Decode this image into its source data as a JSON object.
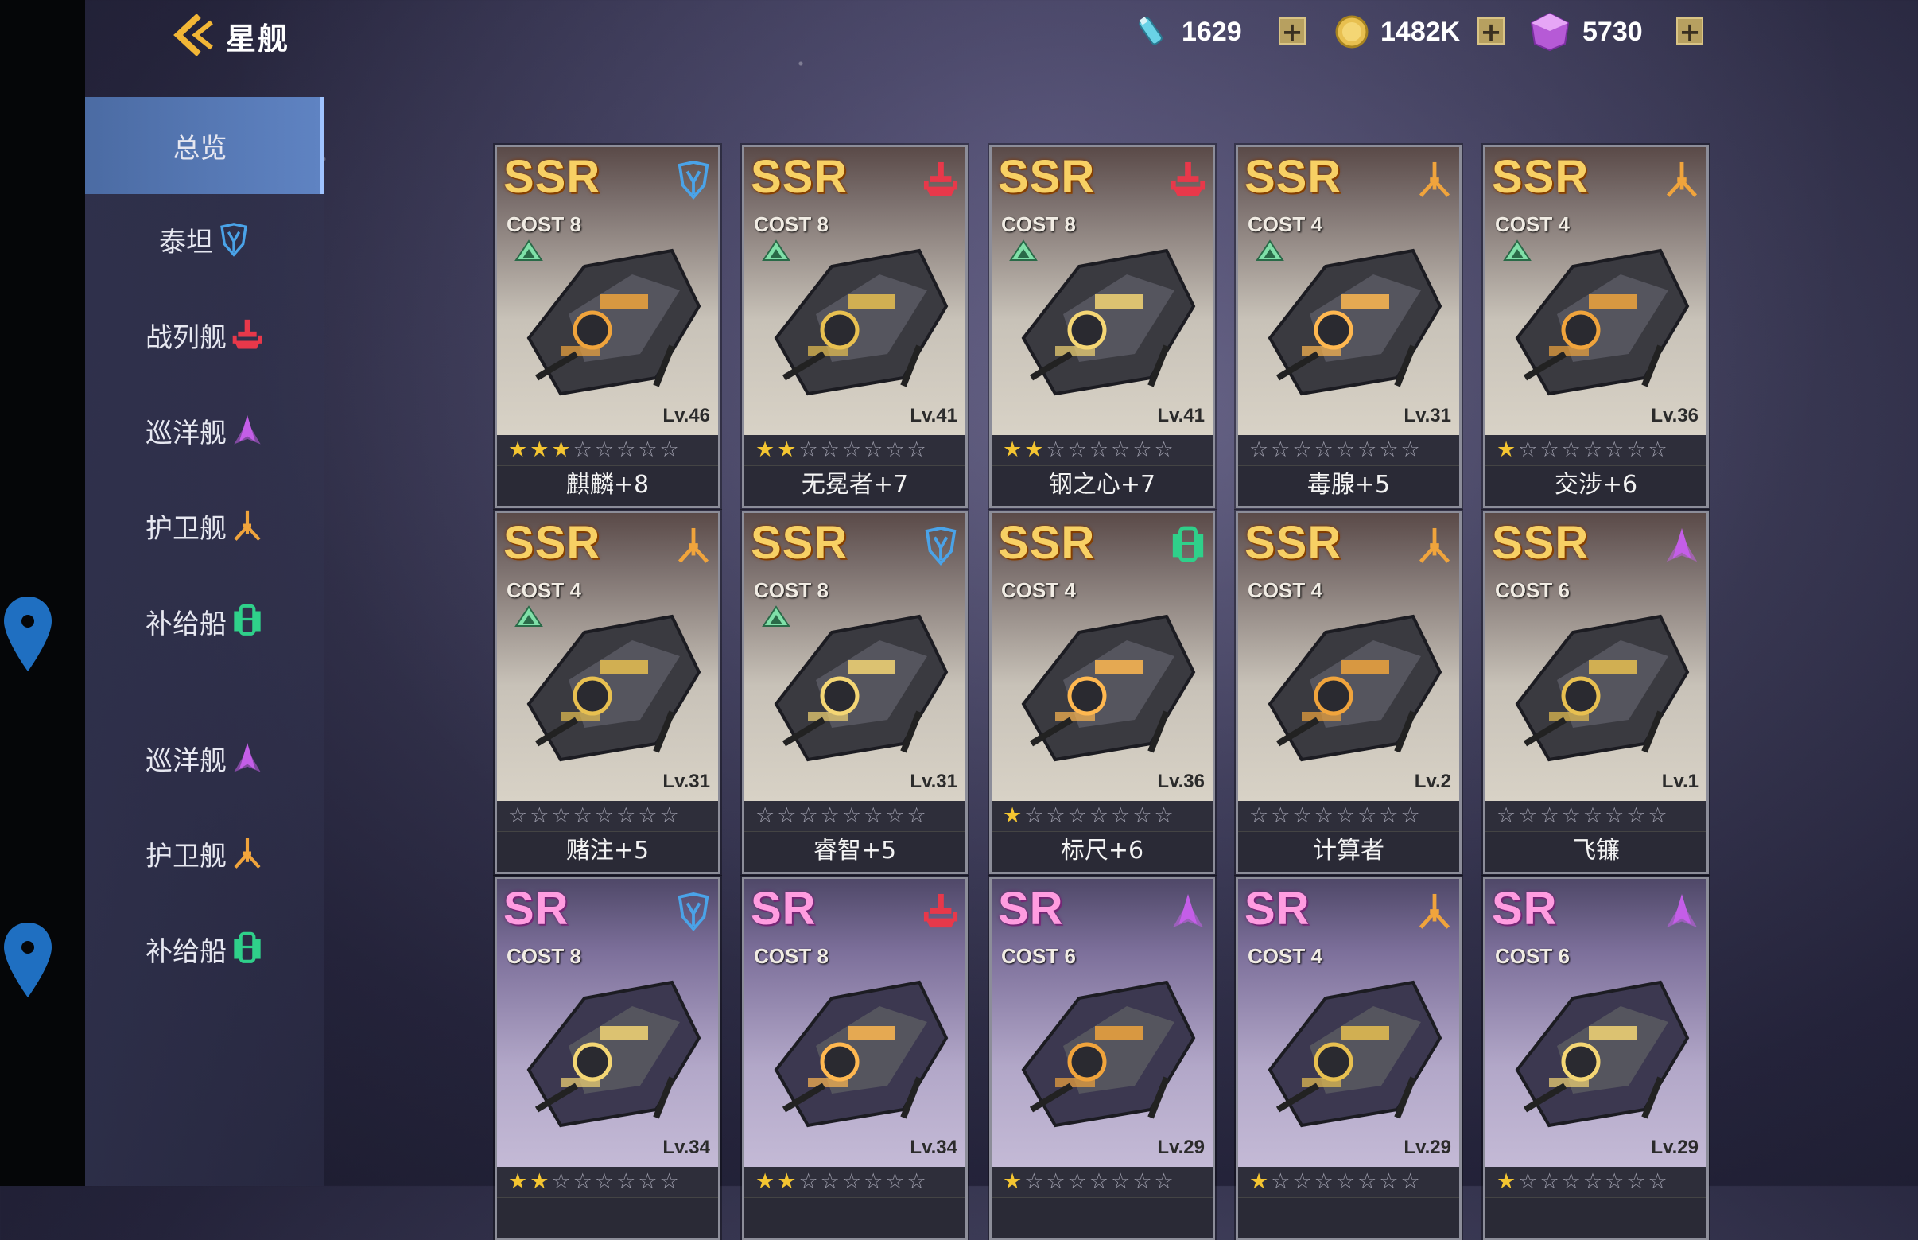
{
  "header": {
    "title": "星舰"
  },
  "resources": [
    {
      "icon": "fuel-icon",
      "value": "1629"
    },
    {
      "icon": "gold-coin-icon",
      "value": "1482K"
    },
    {
      "icon": "crystal-icon",
      "value": "5730"
    }
  ],
  "sidebar": {
    "items": [
      {
        "label": "总览",
        "icon": "",
        "active": true
      },
      {
        "label": "泰坦",
        "icon": "titan-icon"
      },
      {
        "label": "战列舰",
        "icon": "battleship-icon"
      },
      {
        "label": "巡洋舰",
        "icon": "cruiser-icon"
      },
      {
        "label": "护卫舰",
        "icon": "frigate-icon"
      },
      {
        "label": "补给船",
        "icon": "supply-icon"
      },
      {
        "label": "巡洋舰",
        "icon": "cruiser-icon"
      },
      {
        "label": "护卫舰",
        "icon": "frigate-icon"
      },
      {
        "label": "补给船",
        "icon": "supply-icon"
      }
    ]
  },
  "ships": [
    {
      "rarity": "SSR",
      "cost": "COST 8",
      "type": "titan",
      "level": "Lv.46",
      "stars": 3,
      "upgrade": true,
      "name": "麒麟+8"
    },
    {
      "rarity": "SSR",
      "cost": "COST 8",
      "type": "battleship",
      "level": "Lv.41",
      "stars": 2,
      "upgrade": true,
      "name": "无冕者+7"
    },
    {
      "rarity": "SSR",
      "cost": "COST 8",
      "type": "battleship",
      "level": "Lv.41",
      "stars": 2,
      "upgrade": true,
      "name": "钢之心+7"
    },
    {
      "rarity": "SSR",
      "cost": "COST 4",
      "type": "frigate",
      "level": "Lv.31",
      "stars": 0,
      "upgrade": true,
      "name": "毒腺+5"
    },
    {
      "rarity": "SSR",
      "cost": "COST 4",
      "type": "frigate",
      "level": "Lv.36",
      "stars": 1,
      "upgrade": true,
      "name": "交涉+6"
    },
    {
      "rarity": "SSR",
      "cost": "COST 4",
      "type": "frigate",
      "level": "Lv.31",
      "stars": 0,
      "upgrade": true,
      "name": "赌注+5"
    },
    {
      "rarity": "SSR",
      "cost": "COST 8",
      "type": "titan",
      "level": "Lv.31",
      "stars": 0,
      "upgrade": true,
      "name": "睿智+5"
    },
    {
      "rarity": "SSR",
      "cost": "COST 4",
      "type": "supply",
      "level": "Lv.36",
      "stars": 1,
      "upgrade": false,
      "name": "标尺+6"
    },
    {
      "rarity": "SSR",
      "cost": "COST 4",
      "type": "frigate",
      "level": "Lv.2",
      "stars": 0,
      "upgrade": false,
      "name": "计算者"
    },
    {
      "rarity": "SSR",
      "cost": "COST 6",
      "type": "cruiser",
      "level": "Lv.1",
      "stars": 0,
      "upgrade": false,
      "name": "飞镰"
    },
    {
      "rarity": "SR",
      "cost": "COST 8",
      "type": "titan",
      "level": "Lv.34",
      "stars": 2,
      "upgrade": false,
      "name": ""
    },
    {
      "rarity": "SR",
      "cost": "COST 8",
      "type": "battleship",
      "level": "Lv.34",
      "stars": 2,
      "upgrade": false,
      "name": ""
    },
    {
      "rarity": "SR",
      "cost": "COST 6",
      "type": "cruiser",
      "level": "Lv.29",
      "stars": 1,
      "upgrade": false,
      "name": ""
    },
    {
      "rarity": "SR",
      "cost": "COST 4",
      "type": "frigate",
      "level": "Lv.29",
      "stars": 1,
      "upgrade": false,
      "name": ""
    },
    {
      "rarity": "SR",
      "cost": "COST 6",
      "type": "cruiser",
      "level": "Lv.29",
      "stars": 1,
      "upgrade": false,
      "name": ""
    }
  ],
  "colors": {
    "titan": "#4aa3e8",
    "battleship": "#e8384a",
    "cruiser": "#c45ee8",
    "frigate": "#f0a43c",
    "supply": "#2fd08a",
    "accent": "#5f83c2"
  }
}
